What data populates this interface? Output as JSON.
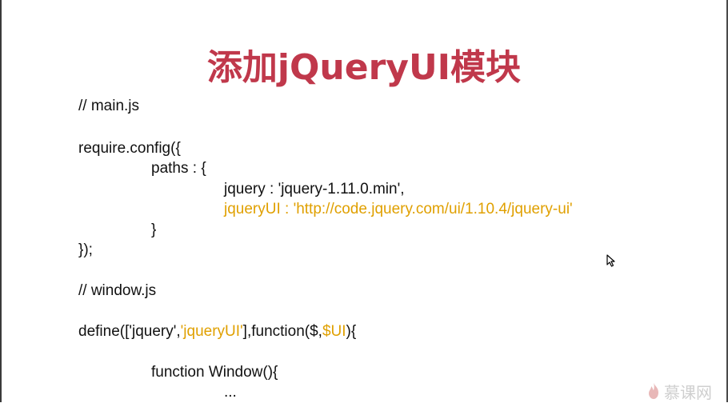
{
  "slide": {
    "title": "添加jQueryUI模块",
    "lines": [
      "// main.js",
      "require.config({",
      "paths : {",
      "jquery : 'jquery-1.11.0.min',",
      "jqueryUI : 'http://code.jquery.com/ui/1.10.4/jquery-ui'",
      "}",
      "});",
      "// window.js",
      "...",
      "function Window(){",
      "..."
    ],
    "define_line": {
      "part1": "define(['jquery',",
      "part2": "'jqueryUI'",
      "part3": "],function($,",
      "part4": "$UI",
      "part5": "){"
    }
  },
  "watermark": {
    "text": "慕课网"
  },
  "colors": {
    "title": "#c0384b",
    "highlight": "#e0a000",
    "text": "#111111"
  }
}
